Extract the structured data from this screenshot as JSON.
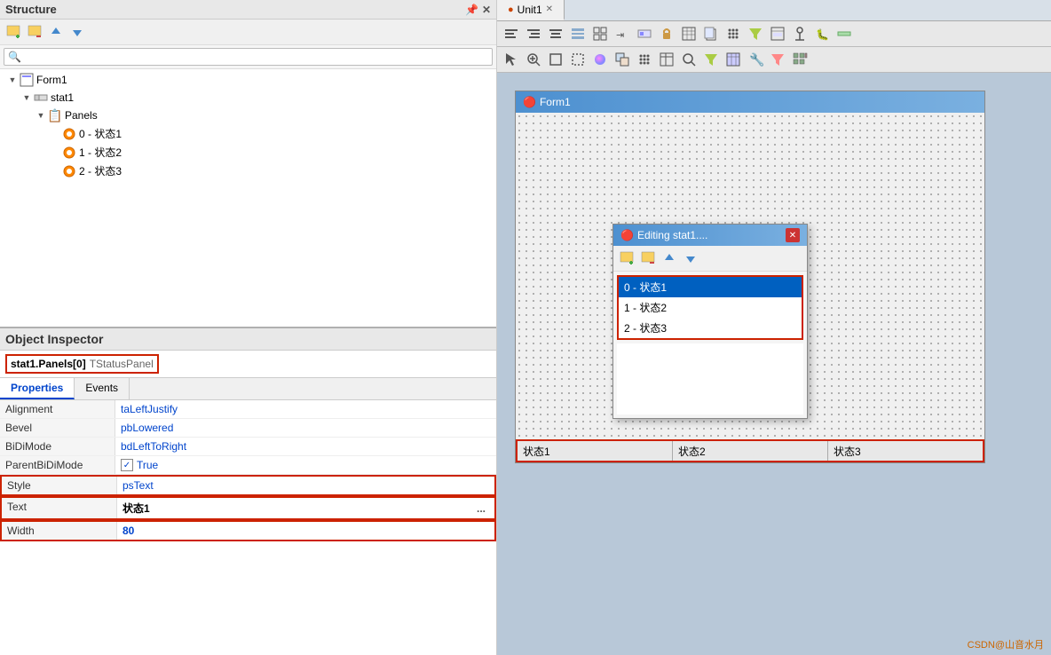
{
  "structure": {
    "title": "Structure",
    "pin_icon": "📌",
    "close_icon": "✕",
    "toolbar": {
      "add_btn": "➕",
      "delete_btn": "🗑",
      "up_btn": "↑",
      "down_btn": "↓"
    },
    "search_placeholder": "🔍",
    "tree": [
      {
        "id": "form1",
        "label": "Form1",
        "level": 1,
        "icon": "form",
        "arrow": "▼"
      },
      {
        "id": "stat1",
        "label": "stat1",
        "level": 2,
        "icon": "component",
        "arrow": "▼"
      },
      {
        "id": "panels",
        "label": "Panels",
        "level": 3,
        "icon": "folder",
        "arrow": "▼"
      },
      {
        "id": "panel0",
        "label": "0 - 状态1",
        "level": 4,
        "icon": "panel_item",
        "arrow": ""
      },
      {
        "id": "panel1",
        "label": "1 - 状态2",
        "level": 4,
        "icon": "panel_item",
        "arrow": ""
      },
      {
        "id": "panel2",
        "label": "2 - 状态3",
        "level": 4,
        "icon": "panel_item",
        "arrow": ""
      }
    ]
  },
  "object_inspector": {
    "title": "Object Inspector",
    "selector": {
      "name": "stat1.Panels[0]",
      "type": "TStatusPanel"
    },
    "tabs": [
      "Properties",
      "Events"
    ],
    "active_tab": "Properties",
    "properties": [
      {
        "name": "Alignment",
        "value": "taLeftJustify",
        "type": "blue"
      },
      {
        "name": "Bevel",
        "value": "pbLowered",
        "type": "blue"
      },
      {
        "name": "BiDiMode",
        "value": "bdLeftToRight",
        "type": "blue"
      },
      {
        "name": "ParentBiDiMode",
        "value": "True",
        "type": "checkbox_true"
      },
      {
        "name": "Style",
        "value": "psText",
        "type": "blue_highlighted"
      },
      {
        "name": "Text",
        "value": "状态1",
        "type": "bold_highlighted"
      },
      {
        "name": "Width",
        "value": "80",
        "type": "bold_highlighted"
      }
    ]
  },
  "right_panel": {
    "tab_bar": {
      "tabs": [
        {
          "label": "Unit1",
          "active": true,
          "closeable": true
        }
      ]
    },
    "toolbar_row1": [
      "⊞",
      "⊟",
      "≡",
      "⊠",
      "⊡",
      "▦",
      "⬛",
      "⬜",
      "≣",
      "⊢",
      "⌥",
      "⌦",
      "⊞",
      "⊟",
      "⊞",
      "⊟",
      "⊞"
    ],
    "toolbar_row2": [
      "⊕",
      "⊗",
      "⊞",
      "⬚",
      "⊛",
      "⊝",
      "⊞",
      "⊟",
      "⊠",
      "⊡",
      "⊢",
      "⊣",
      "⊤",
      "⊥",
      "⊦"
    ],
    "form": {
      "title": "Form1",
      "icon": "🔴"
    },
    "status_bar": {
      "panels": [
        "状态1",
        "状态2",
        "状态3"
      ]
    }
  },
  "editing_dialog": {
    "title": "Editing stat1....",
    "close_btn": "✕",
    "toolbar": {
      "add_btn": "➕",
      "delete_btn": "🗑",
      "up_btn": "↑",
      "down_btn": "↓"
    },
    "list_items": [
      {
        "label": "0 - 状态1",
        "selected": true
      },
      {
        "label": "1 - 状态2",
        "selected": false
      },
      {
        "label": "2 - 状态3",
        "selected": false
      }
    ]
  },
  "watermark": "CSDN@山音水月"
}
